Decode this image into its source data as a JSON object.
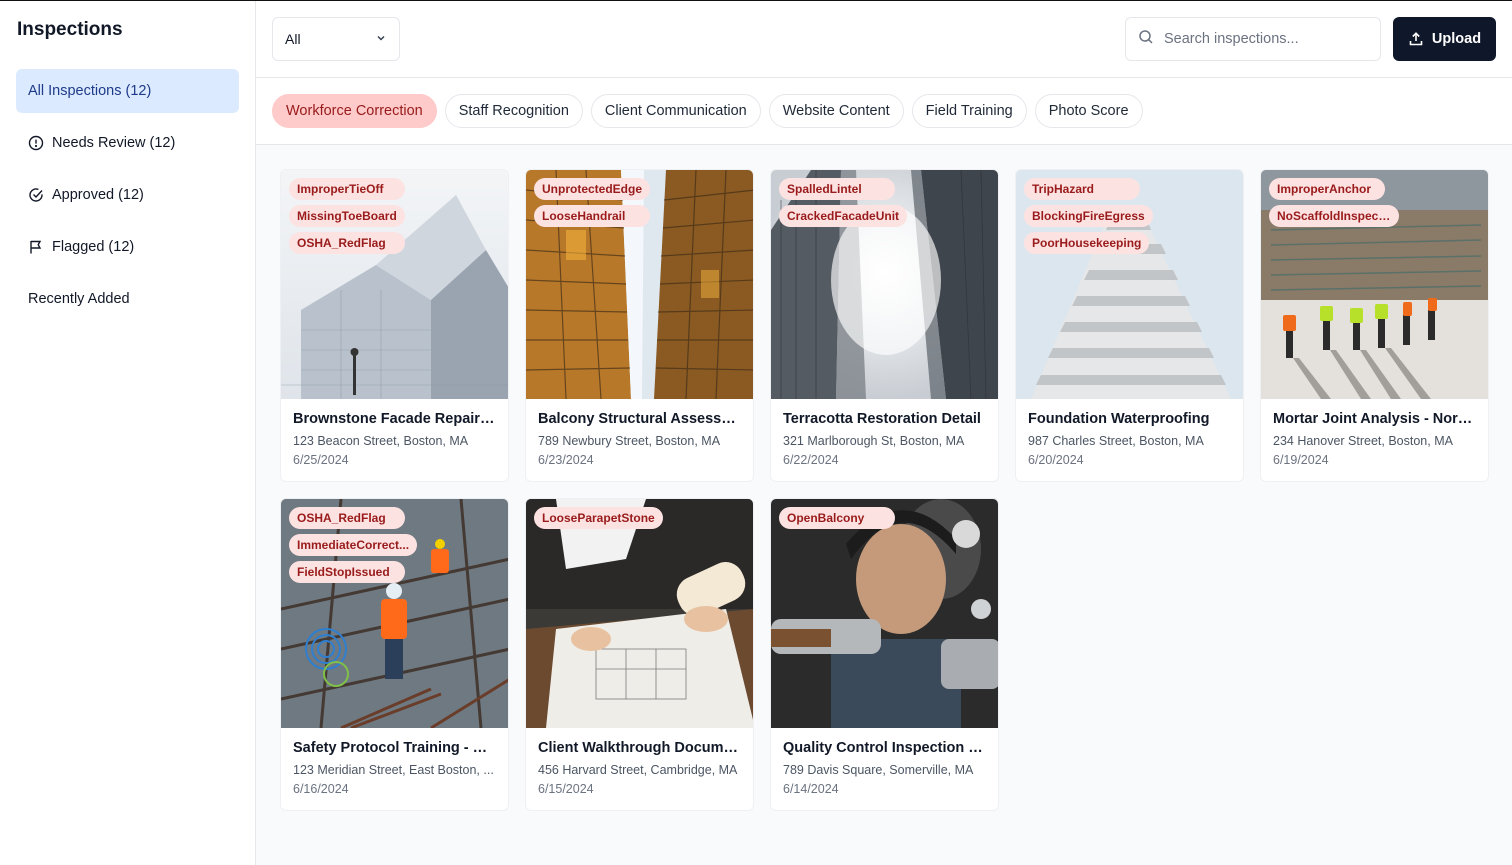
{
  "sidebar": {
    "title": "Inspections",
    "items": [
      {
        "label": "All Inspections (12)",
        "icon": "none",
        "active": true
      },
      {
        "label": "Needs Review (12)",
        "icon": "alert-circle-icon",
        "active": false
      },
      {
        "label": "Approved (12)",
        "icon": "check-circle-icon",
        "active": false
      },
      {
        "label": "Flagged (12)",
        "icon": "flag-icon",
        "active": false
      },
      {
        "label": "Recently Added",
        "icon": "none",
        "active": false
      }
    ]
  },
  "header": {
    "filter_value": "All",
    "search_placeholder": "Search inspections...",
    "upload_label": "Upload"
  },
  "chips": [
    {
      "label": "Workforce Correction",
      "active": true
    },
    {
      "label": "Staff Recognition",
      "active": false
    },
    {
      "label": "Client Communication",
      "active": false
    },
    {
      "label": "Website Content",
      "active": false
    },
    {
      "label": "Field Training",
      "active": false
    },
    {
      "label": "Photo Score",
      "active": false
    }
  ],
  "cards": [
    {
      "title": "Brownstone Facade Repair - ...",
      "address": "123 Beacon Street, Boston, MA",
      "date": "6/25/2024",
      "tags": [
        "ImproperTieOff",
        "MissingToeBoard",
        "OSHA_RedFlag"
      ]
    },
    {
      "title": "Balcony Structural Assessme...",
      "address": "789 Newbury Street, Boston, MA",
      "date": "6/23/2024",
      "tags": [
        "UnprotectedEdge",
        "LooseHandrail"
      ]
    },
    {
      "title": "Terracotta Restoration Detail",
      "address": "321 Marlborough St, Boston, MA",
      "date": "6/22/2024",
      "tags": [
        "SpalledLintel",
        "CrackedFacadeUnit"
      ]
    },
    {
      "title": "Foundation Waterproofing",
      "address": "987 Charles Street, Boston, MA",
      "date": "6/20/2024",
      "tags": [
        "TripHazard",
        "BlockingFireEgress",
        "PoorHousekeeping"
      ]
    },
    {
      "title": "Mortar Joint Analysis - North...",
      "address": "234 Hanover Street, Boston, MA",
      "date": "6/19/2024",
      "tags": [
        "ImproperAnchor",
        "NoScaffoldInspect..."
      ]
    },
    {
      "title": "Safety Protocol Training - Ea...",
      "address": "123 Meridian Street, East Boston, ...",
      "date": "6/16/2024",
      "tags": [
        "OSHA_RedFlag",
        "ImmediateCorrect...",
        "FieldStopIssued"
      ]
    },
    {
      "title": "Client Walkthrough Documen...",
      "address": "456 Harvard Street, Cambridge, MA",
      "date": "6/15/2024",
      "tags": [
        "LooseParapetStone"
      ]
    },
    {
      "title": "Quality Control Inspection - ...",
      "address": "789 Davis Square, Somerville, MA",
      "date": "6/14/2024",
      "tags": [
        "OpenBalcony"
      ]
    }
  ],
  "colors": {
    "active_nav_bg": "#dbeafe",
    "active_chip_bg": "#fecaca",
    "tag_bg": "#fde2e2",
    "tag_text": "#991b1b",
    "upload_bg": "#0f172a"
  }
}
